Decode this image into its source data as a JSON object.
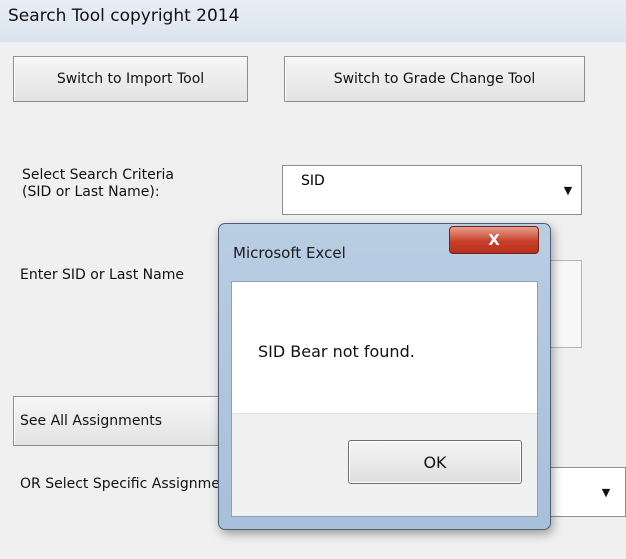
{
  "window": {
    "title": "Search Tool copyright 2014"
  },
  "buttons": {
    "switch_import": "Switch to Import Tool",
    "switch_grade": "Switch to Grade Change Tool",
    "see_all": "See All Assignments"
  },
  "criteria": {
    "label": "Select Search Criteria\n(SID or Last Name):",
    "selected": "SID"
  },
  "search": {
    "label": "Enter SID or Last Name"
  },
  "assignment": {
    "label": "OR Select Specific Assignment"
  },
  "dialog": {
    "title": "Microsoft Excel",
    "close_label": "X",
    "message": "SID Bear not found.",
    "ok_label": "OK"
  },
  "icons": {
    "dropdown": "chevron-down-icon",
    "close": "close-icon"
  }
}
